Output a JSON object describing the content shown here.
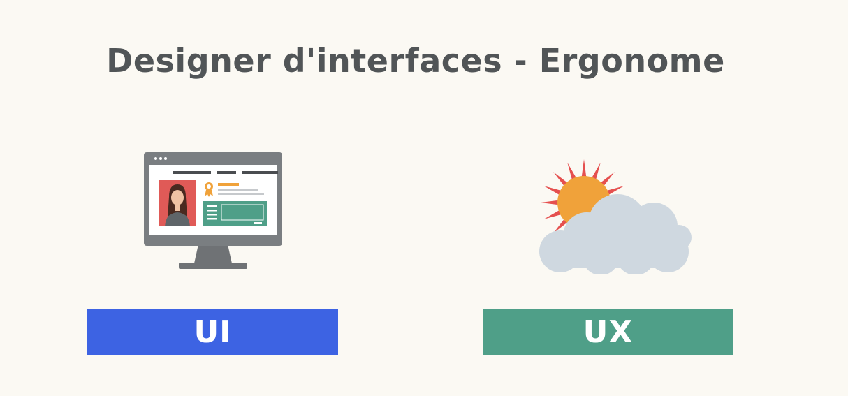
{
  "header": {
    "title": "Designer d'interfaces - Ergonome"
  },
  "left": {
    "label": "UI",
    "bar_color": "#3d63e3",
    "icon": "computer-monitor-icon"
  },
  "right": {
    "label": "UX",
    "bar_color": "#4f9f88",
    "icon": "sun-behind-cloud-icon"
  },
  "colors": {
    "background": "#fbf9f3",
    "title": "#515557",
    "monitor_frame": "#7a7e81",
    "photo_bg": "#e05a57",
    "panel_green": "#4f9f88",
    "sun": "#f0a23a",
    "sun_rays": "#e5504f",
    "cloud": "#cfd8e0"
  }
}
